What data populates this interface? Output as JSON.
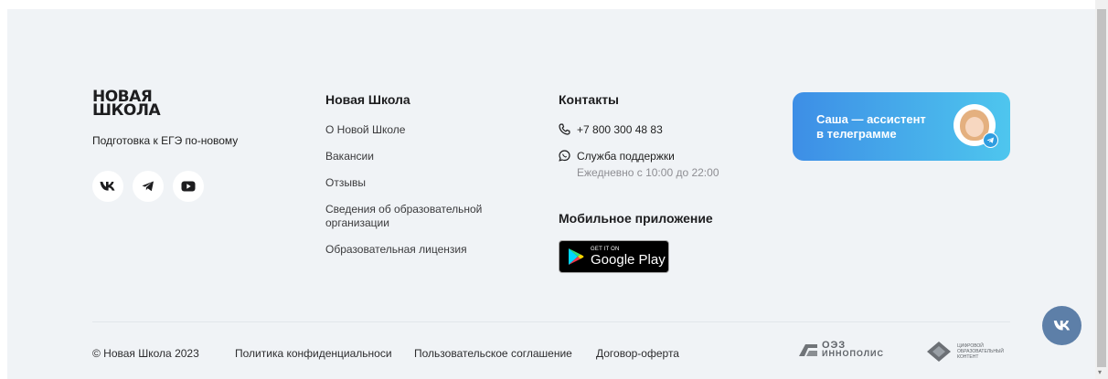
{
  "brand": {
    "logo_line1": "НОВАЯ",
    "logo_line2": "ШКОЛА",
    "tagline": "Подготовка к ЕГЭ по-новому"
  },
  "socials": [
    {
      "icon": "vk-icon"
    },
    {
      "icon": "telegram-icon"
    },
    {
      "icon": "youtube-icon"
    }
  ],
  "school_column": {
    "title": "Новая Школа",
    "links": [
      "О Новой Школе",
      "Вакансии",
      "Отзывы",
      "Сведения об образовательной организации",
      "Образовательная лицензия"
    ]
  },
  "contacts": {
    "title": "Контакты",
    "phone": "+7 800 300 48 83",
    "support_label": "Служба поддержки",
    "support_hours": "Ежедневно с 10:00 до 22:00"
  },
  "mobile_app": {
    "title": "Мобильное приложение",
    "store_small": "GET IT ON",
    "store_big": "Google Play"
  },
  "assistant": {
    "line1": "Саша — ассистент",
    "line2": "в телеграмме"
  },
  "bottom": {
    "copyright": "© Новая Школа 2023",
    "privacy": "Политика конфиденциальноси",
    "agreement": "Пользовательское соглашение",
    "offer": "Договор-оферта"
  },
  "partners": {
    "oez_line1": "ОЭЗ",
    "oez_line2": "ИННОПОЛИС",
    "digital_line1": "ЦИФРОВОЙ",
    "digital_line2": "ОБРАЗОВАТЕЛЬНЫЙ",
    "digital_line3": "КОНТЕНТ"
  },
  "colors": {
    "footer_bg": "#f0f3f6",
    "assistant_gradient_start": "#3d8ee6",
    "assistant_gradient_end": "#4ec6ee",
    "vk_float": "#5d7fa8"
  }
}
